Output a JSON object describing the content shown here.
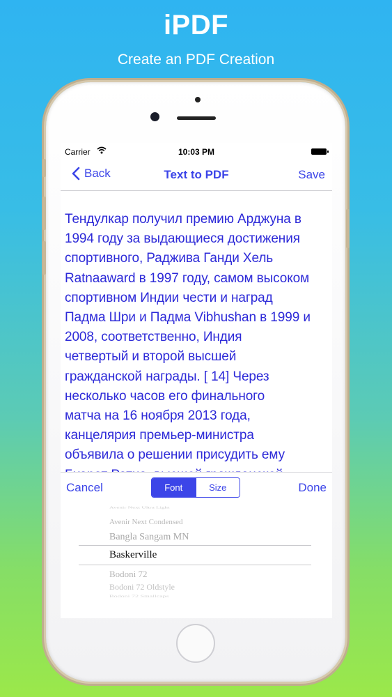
{
  "hero": {
    "title": "iPDF",
    "subtitle": "Create an PDF Creation"
  },
  "statusbar": {
    "carrier": "Carrier",
    "time": "10:03 PM"
  },
  "nav": {
    "back_label": "Back",
    "title": "Text to PDF",
    "save_label": "Save"
  },
  "document": {
    "lines": [
      "Тендулкар получил премию Арджуна в",
      "1994 году за выдающиеся достижения",
      "спортивного, Раджива Ганди Хель",
      "Ratnaaward в 1997 году, самом высоком",
      "спортивном Индии чести и наград",
      "Падма Шри и Падма Vibhushan в 1999 и",
      "2008, соответственно, Индия",
      "четвертый и второй высшей",
      "гражданской награды. [ 14] Через",
      "несколько часов его финального",
      "матча на 16 ноября 2013 года,",
      "канцелярия премьер-министра",
      "объявила о решении присудить ему",
      "Бхарат Ратна, высшей гражданской"
    ]
  },
  "toolbar": {
    "cancel_label": "Cancel",
    "done_label": "Done",
    "segments": [
      "Font",
      "Size"
    ],
    "selected_segment": "Font"
  },
  "picker": {
    "items": [
      {
        "label": "Avenir Next Ultra Light"
      },
      {
        "label": "Avenir Next Condensed"
      },
      {
        "label": "Bangla Sangam MN"
      },
      {
        "label": "Baskerville"
      },
      {
        "label": "Bodoni 72"
      },
      {
        "label": "Bodoni 72 Oldstyle"
      },
      {
        "label": "Bodoni 72 Smallcaps"
      }
    ],
    "selected": "Baskerville"
  },
  "colors": {
    "accent": "#3c45e8",
    "text": "#2d2ad8"
  }
}
